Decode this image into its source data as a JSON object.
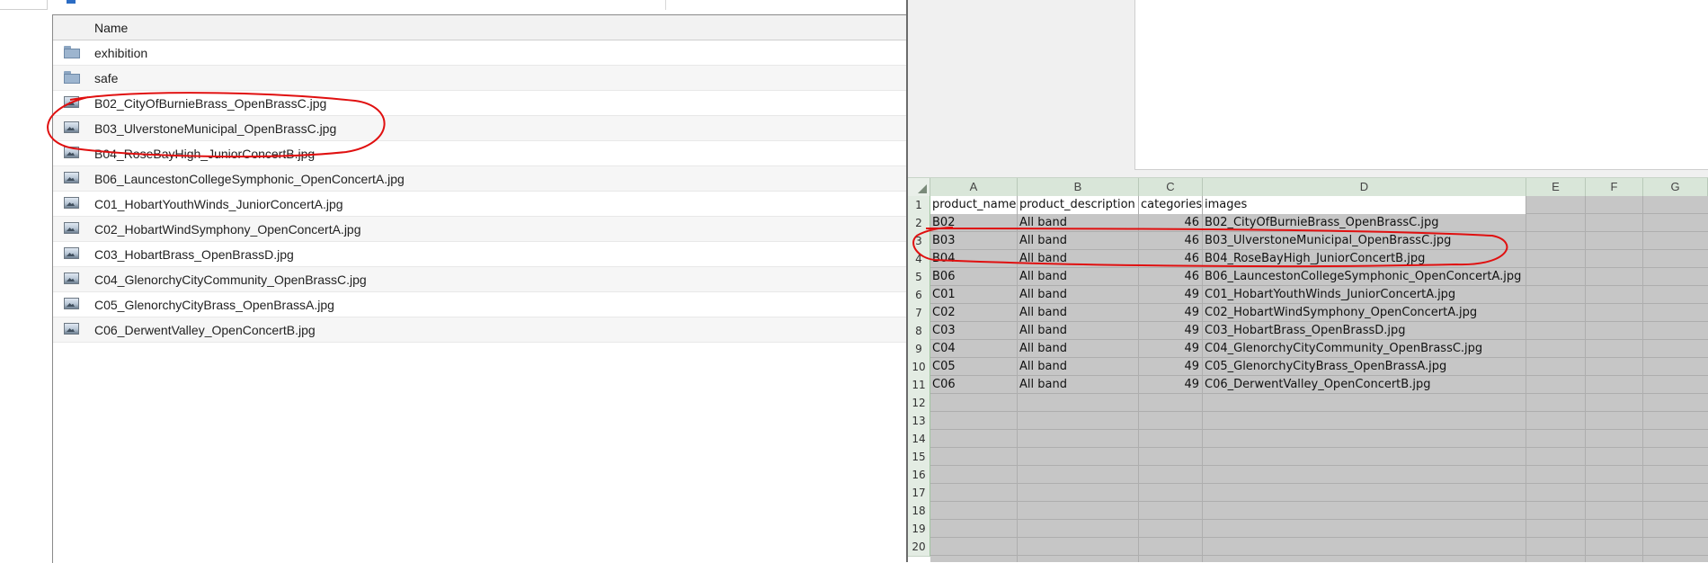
{
  "explorer": {
    "column_header": "Name",
    "files": [
      {
        "name": "exhibition",
        "type": "folder"
      },
      {
        "name": "safe",
        "type": "folder"
      },
      {
        "name": "B02_CityOfBurnieBrass_OpenBrassC.jpg",
        "type": "image"
      },
      {
        "name": "B03_UlverstoneMunicipal_OpenBrassC.jpg",
        "type": "image"
      },
      {
        "name": "B04_RoseBayHigh_JuniorConcertB.jpg",
        "type": "image"
      },
      {
        "name": "B06_LauncestonCollegeSymphonic_OpenConcertA.jpg",
        "type": "image"
      },
      {
        "name": "C01_HobartYouthWinds_JuniorConcertA.jpg",
        "type": "image"
      },
      {
        "name": "C02_HobartWindSymphony_OpenConcertA.jpg",
        "type": "image"
      },
      {
        "name": "C03_HobartBrass_OpenBrassD.jpg",
        "type": "image"
      },
      {
        "name": "C04_GlenorchyCityCommunity_OpenBrassC.jpg",
        "type": "image"
      },
      {
        "name": "C05_GlenorchyCityBrass_OpenBrassA.jpg",
        "type": "image"
      },
      {
        "name": "C06_DerwentValley_OpenConcertB.jpg",
        "type": "image"
      }
    ]
  },
  "spreadsheet": {
    "columns": [
      "A",
      "B",
      "C",
      "D",
      "E",
      "F",
      "G"
    ],
    "row_numbers": [
      "1",
      "2",
      "3",
      "4",
      "5",
      "6",
      "7",
      "8",
      "9",
      "10",
      "11",
      "12",
      "13",
      "14",
      "15",
      "16",
      "17",
      "18",
      "19",
      "20"
    ],
    "headers": [
      "product_name",
      "product_description",
      "categories",
      "images"
    ],
    "rows": [
      [
        "B02",
        "All band",
        "46",
        "B02_CityOfBurnieBrass_OpenBrassC.jpg"
      ],
      [
        "B03",
        "All band",
        "46",
        "B03_UlverstoneMunicipal_OpenBrassC.jpg"
      ],
      [
        "B04",
        "All band",
        "46",
        "B04_RoseBayHigh_JuniorConcertB.jpg"
      ],
      [
        "B06",
        "All band",
        "46",
        "B06_LauncestonCollegeSymphonic_OpenConcertA.jpg"
      ],
      [
        "C01",
        "All band",
        "49",
        "C01_HobartYouthWinds_JuniorConcertA.jpg"
      ],
      [
        "C02",
        "All band",
        "49",
        "C02_HobartWindSymphony_OpenConcertA.jpg"
      ],
      [
        "C03",
        "All band",
        "49",
        "C03_HobartBrass_OpenBrassD.jpg"
      ],
      [
        "C04",
        "All band",
        "49",
        "C04_GlenorchyCityCommunity_OpenBrassC.jpg"
      ],
      [
        "C05",
        "All band",
        "49",
        "C05_GlenorchyCityBrass_OpenBrassA.jpg"
      ],
      [
        "C06",
        "All band",
        "49",
        "C06_DerwentValley_OpenConcertB.jpg"
      ]
    ]
  },
  "colors": {
    "annotation": "#e01010",
    "sheet_selected": "#c6c6c6",
    "header_green": "#d9e6d9"
  }
}
